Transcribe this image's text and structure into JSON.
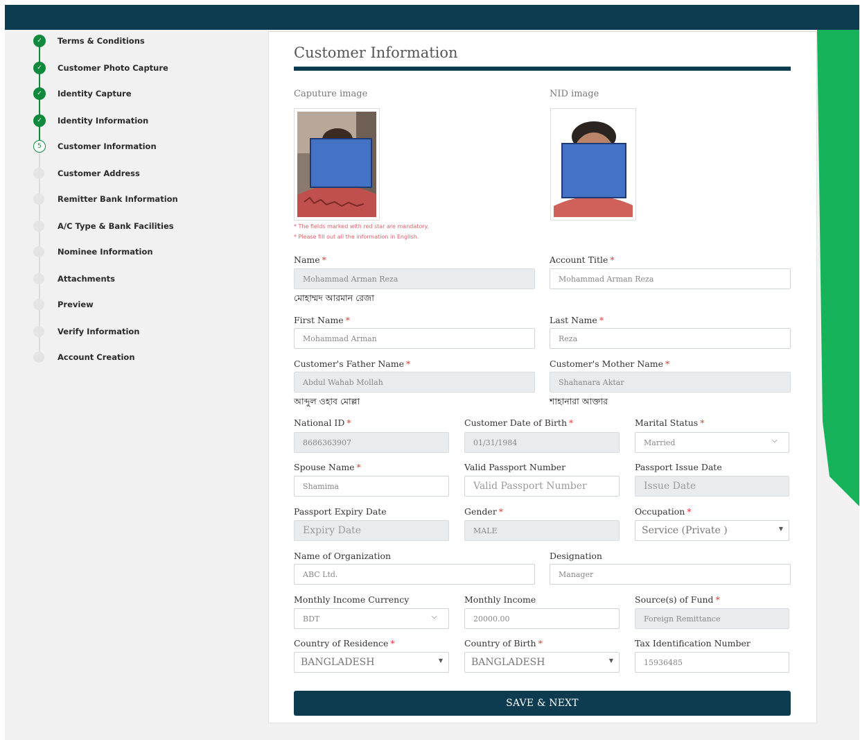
{
  "colors": {
    "brand_dark": "#0d3b4f",
    "accent_green": "#0f8a3c",
    "required": "#e53935",
    "mask_blue": "#4472c4"
  },
  "sidebar": {
    "steps": [
      {
        "label": "Terms & Conditions",
        "state": "done"
      },
      {
        "label": "Customer Photo Capture",
        "state": "done"
      },
      {
        "label": "Identity Capture",
        "state": "done"
      },
      {
        "label": "Identity Information",
        "state": "done"
      },
      {
        "label": "Customer Information",
        "state": "current",
        "number": "5"
      },
      {
        "label": "Customer Address",
        "state": "todo"
      },
      {
        "label": "Remitter Bank Information",
        "state": "todo"
      },
      {
        "label": "A/C Type & Bank Facilities",
        "state": "todo"
      },
      {
        "label": "Nominee Information",
        "state": "todo"
      },
      {
        "label": "Attachments",
        "state": "todo"
      },
      {
        "label": "Preview",
        "state": "todo"
      },
      {
        "label": "Verify Information",
        "state": "todo"
      },
      {
        "label": "Account Creation",
        "state": "todo"
      }
    ]
  },
  "card": {
    "title": "Customer Information",
    "capture_label": "Caputure image",
    "nid_label": "NID image",
    "note_mandatory": "* The fields marked with red star are mandatory.",
    "note_english": "* Please fill out all the information in English.",
    "required_mark": "*"
  },
  "form": {
    "name": {
      "label": "Name",
      "value": "Mohammad Arman Reza",
      "bangla": "মোহাম্মদ আরমান রেজা"
    },
    "account_title": {
      "label": "Account Title",
      "value": "Mohammad Arman Reza"
    },
    "first_name": {
      "label": "First Name",
      "value": "Mohammad Arman"
    },
    "last_name": {
      "label": "Last Name",
      "value": "Reza"
    },
    "father_name": {
      "label": "Customer's Father Name",
      "value": "Abdul Wahab Mollah",
      "bangla": "আব্দুল ওহাব মোল্লা"
    },
    "mother_name": {
      "label": "Customer's Mother Name",
      "value": "Shahanara Aktar",
      "bangla": "শাহানারা আক্তার"
    },
    "national_id": {
      "label": "National ID",
      "value": "8686363907"
    },
    "dob": {
      "label": "Customer Date of Birth",
      "value": "01/31/1984"
    },
    "marital_status": {
      "label": "Marital Status",
      "value": "Married"
    },
    "spouse_name": {
      "label": "Spouse Name",
      "value": "Shamima"
    },
    "passport_number": {
      "label": "Valid Passport Number",
      "placeholder": "Valid Passport Number"
    },
    "passport_issue": {
      "label": "Passport Issue Date",
      "placeholder": "Issue Date"
    },
    "passport_expiry": {
      "label": "Passport Expiry Date",
      "placeholder": "Expiry Date"
    },
    "gender": {
      "label": "Gender",
      "value": "MALE"
    },
    "occupation": {
      "label": "Occupation",
      "value": "Service (Private )"
    },
    "organization": {
      "label": "Name of Organization",
      "value": "ABC Ltd."
    },
    "designation": {
      "label": "Designation",
      "value": "Manager"
    },
    "income_currency": {
      "label": "Monthly Income Currency",
      "value": "BDT"
    },
    "monthly_income": {
      "label": "Monthly Income",
      "value": "20000.00"
    },
    "source_fund": {
      "label": "Source(s) of Fund",
      "value": "Foreign Remittance"
    },
    "residence": {
      "label": "Country of Residence",
      "value": "BANGLADESH"
    },
    "birth_country": {
      "label": "Country of Birth",
      "value": "BANGLADESH"
    },
    "tin": {
      "label": "Tax Identification Number",
      "value": "15936485"
    }
  },
  "actions": {
    "save_next": "SAVE & NEXT"
  }
}
